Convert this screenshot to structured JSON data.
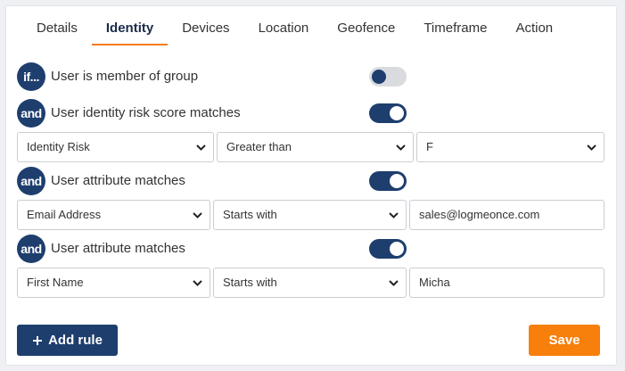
{
  "tabs": [
    {
      "label": "Details"
    },
    {
      "label": "Identity",
      "active": true
    },
    {
      "label": "Devices"
    },
    {
      "label": "Location"
    },
    {
      "label": "Geofence"
    },
    {
      "label": "Timeframe"
    },
    {
      "label": "Action"
    }
  ],
  "rules": [
    {
      "connector": "if...",
      "text": "User is member of group",
      "enabled": false
    },
    {
      "connector": "and",
      "text": "User identity risk score matches",
      "enabled": true,
      "fields": {
        "first": "Identity Risk",
        "operator": "Greater than",
        "value": "F"
      }
    },
    {
      "connector": "and",
      "text": "User attribute matches",
      "enabled": true,
      "fields": {
        "first": "Email Address",
        "operator": "Starts with",
        "value": "sales@logmeonce.com"
      }
    },
    {
      "connector": "and",
      "text": "User attribute matches",
      "enabled": true,
      "fields": {
        "first": "First Name",
        "operator": "Starts with",
        "value": "Micha"
      }
    }
  ],
  "buttons": {
    "add_rule": "Add rule",
    "save": "Save"
  },
  "icons": {
    "dropdown": "chevron-down-icon",
    "add": "plus-icon"
  },
  "colors": {
    "primary": "#1e3e6e",
    "accent": "#f47c20",
    "save": "#f77f0c"
  }
}
